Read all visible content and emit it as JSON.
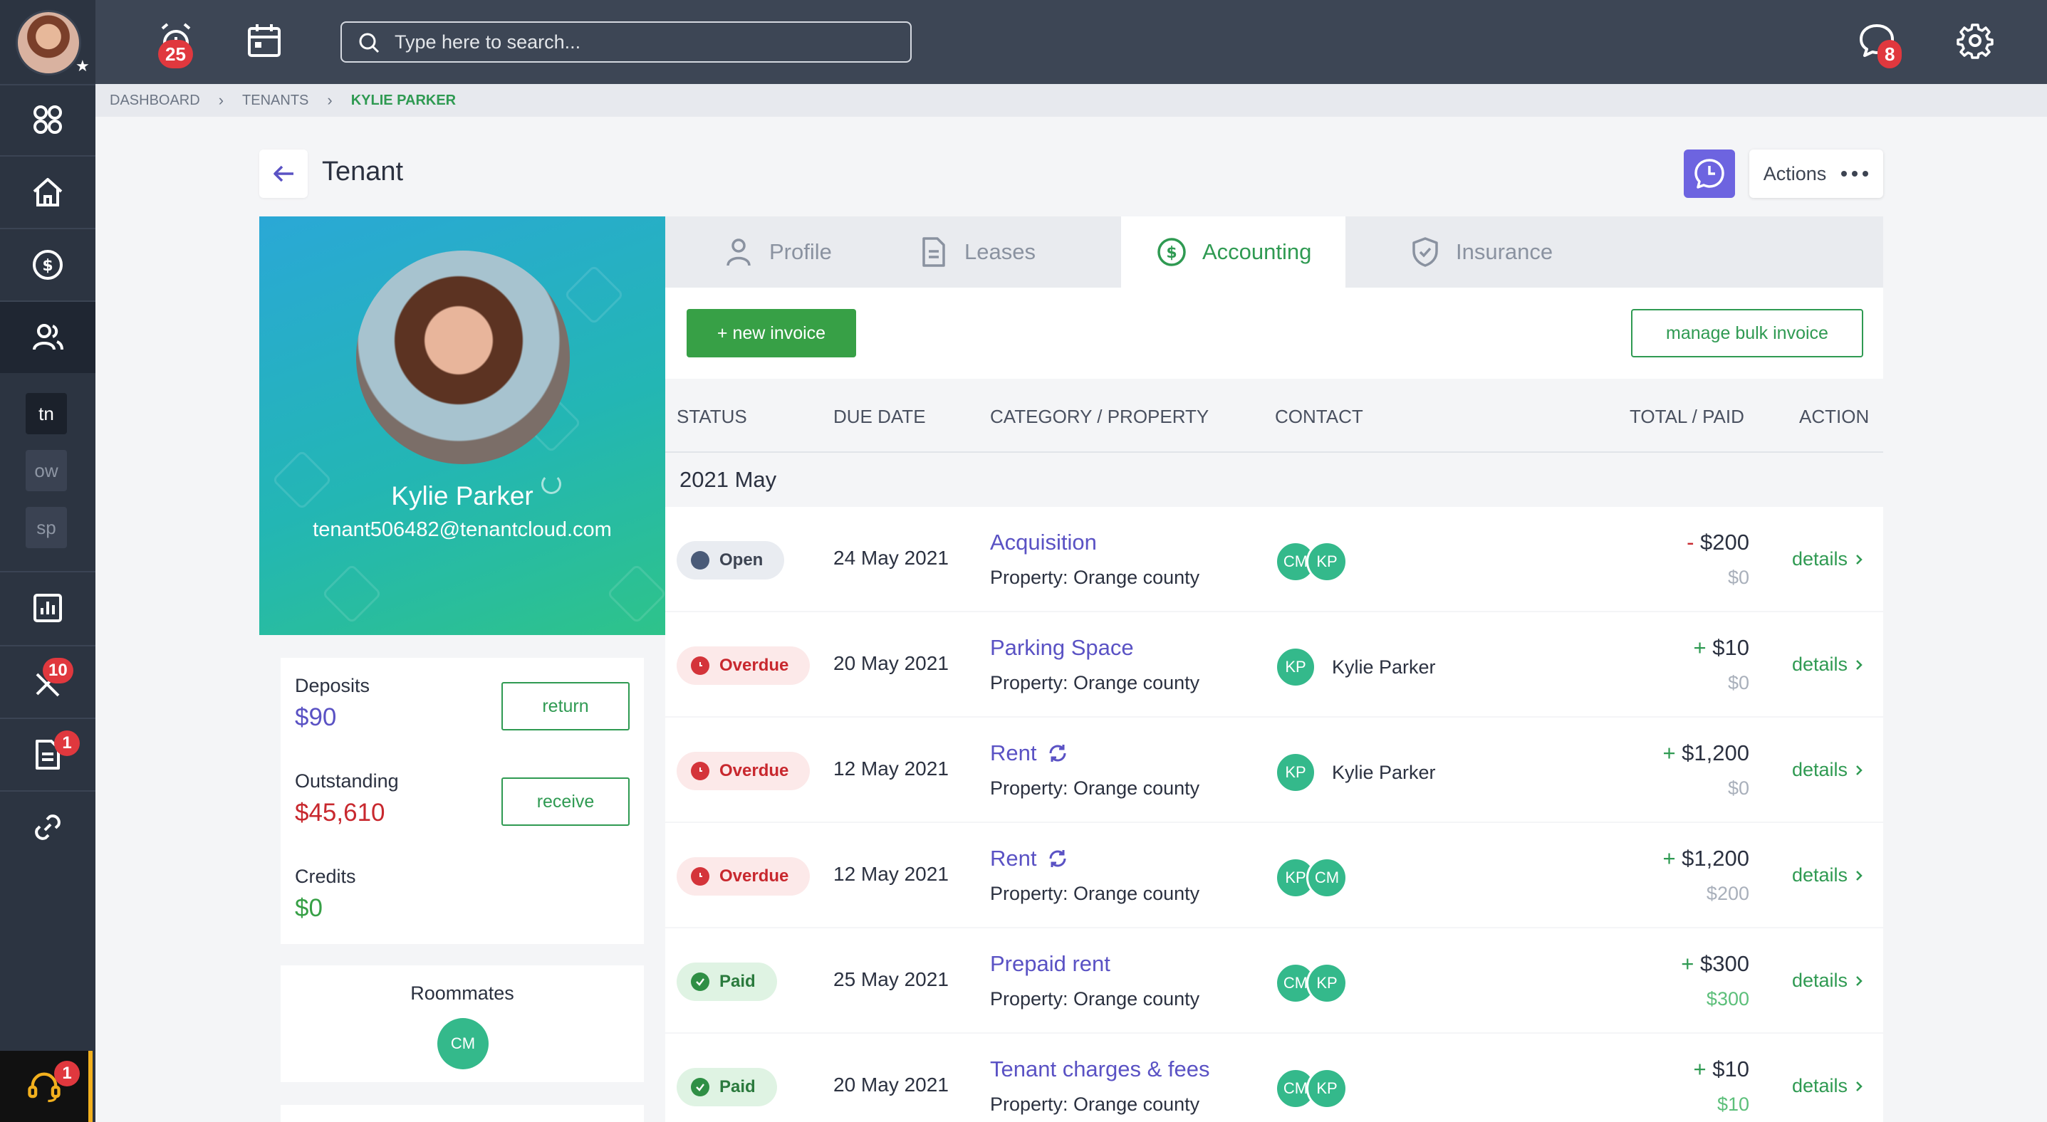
{
  "topbar": {
    "notifications_count": "25",
    "messages_count": "8",
    "search_placeholder": "Type here to search..."
  },
  "sidebar": {
    "tools_badge": "10",
    "docs_badge": "1",
    "support_badge": "1",
    "tags": [
      "tn",
      "ow",
      "sp"
    ]
  },
  "breadcrumb": [
    "DASHBOARD",
    "TENANTS",
    "KYLIE PARKER"
  ],
  "page": {
    "title": "Tenant",
    "actions_label": "Actions"
  },
  "profile": {
    "name": "Kylie Parker",
    "email": "tenant506482@tenantcloud.com"
  },
  "balances": {
    "deposits_label": "Deposits",
    "deposits_value": "$90",
    "return_label": "return",
    "outstanding_label": "Outstanding",
    "outstanding_value": "$45,610",
    "receive_label": "receive",
    "credits_label": "Credits",
    "credits_value": "$0"
  },
  "roommates": {
    "title": "Roommates",
    "avatar": "CM"
  },
  "tabs": [
    "Profile",
    "Leases",
    "Accounting",
    "Insurance"
  ],
  "toolbar": {
    "new_invoice": "+ new invoice",
    "bulk_invoice": "manage bulk invoice"
  },
  "table": {
    "headers": [
      "STATUS",
      "DUE DATE",
      "CATEGORY / PROPERTY",
      "CONTACT",
      "TOTAL / PAID",
      "ACTION"
    ],
    "group": "2021 May",
    "details_label": "details",
    "rows": [
      {
        "status": "Open",
        "due": "24 May 2021",
        "category": "Acquisition",
        "property": "Property: Orange county",
        "sign": "-",
        "total": "$200",
        "paid": "$0",
        "contact_name": ""
      },
      {
        "status": "Overdue",
        "due": "20 May 2021",
        "category": "Parking Space",
        "property": "Property: Orange county",
        "sign": "+",
        "total": "$10",
        "paid": "$0",
        "contact_name": "Kylie Parker"
      },
      {
        "status": "Overdue",
        "due": "12 May 2021",
        "category": "Rent",
        "property": "Property: Orange county",
        "sign": "+",
        "total": "$1,200",
        "paid": "$0",
        "contact_name": "Kylie Parker"
      },
      {
        "status": "Overdue",
        "due": "12 May 2021",
        "category": "Rent",
        "property": "Property: Orange county",
        "sign": "+",
        "total": "$1,200",
        "paid": "$200",
        "contact_name": ""
      },
      {
        "status": "Paid",
        "due": "25 May 2021",
        "category": "Prepaid rent",
        "property": "Property: Orange county",
        "sign": "+",
        "total": "$300",
        "paid": "$300",
        "contact_name": ""
      },
      {
        "status": "Paid",
        "due": "20 May 2021",
        "category": "Tenant charges & fees",
        "property": "Property: Orange county",
        "sign": "+",
        "total": "$10",
        "paid": "$10",
        "contact_name": ""
      }
    ],
    "row_avatars": [
      [
        "CM",
        "KP"
      ],
      [
        "KP"
      ],
      [
        "KP"
      ],
      [
        "KP",
        "CM"
      ],
      [
        "CM",
        "KP"
      ],
      [
        "CM",
        "KP"
      ]
    ]
  },
  "colors": {
    "accent_green": "#2f9a52",
    "link_purple": "#5a52c4",
    "overdue_red": "#c8282e",
    "sidebar": "#2c3441",
    "topbar": "#3d4655"
  }
}
